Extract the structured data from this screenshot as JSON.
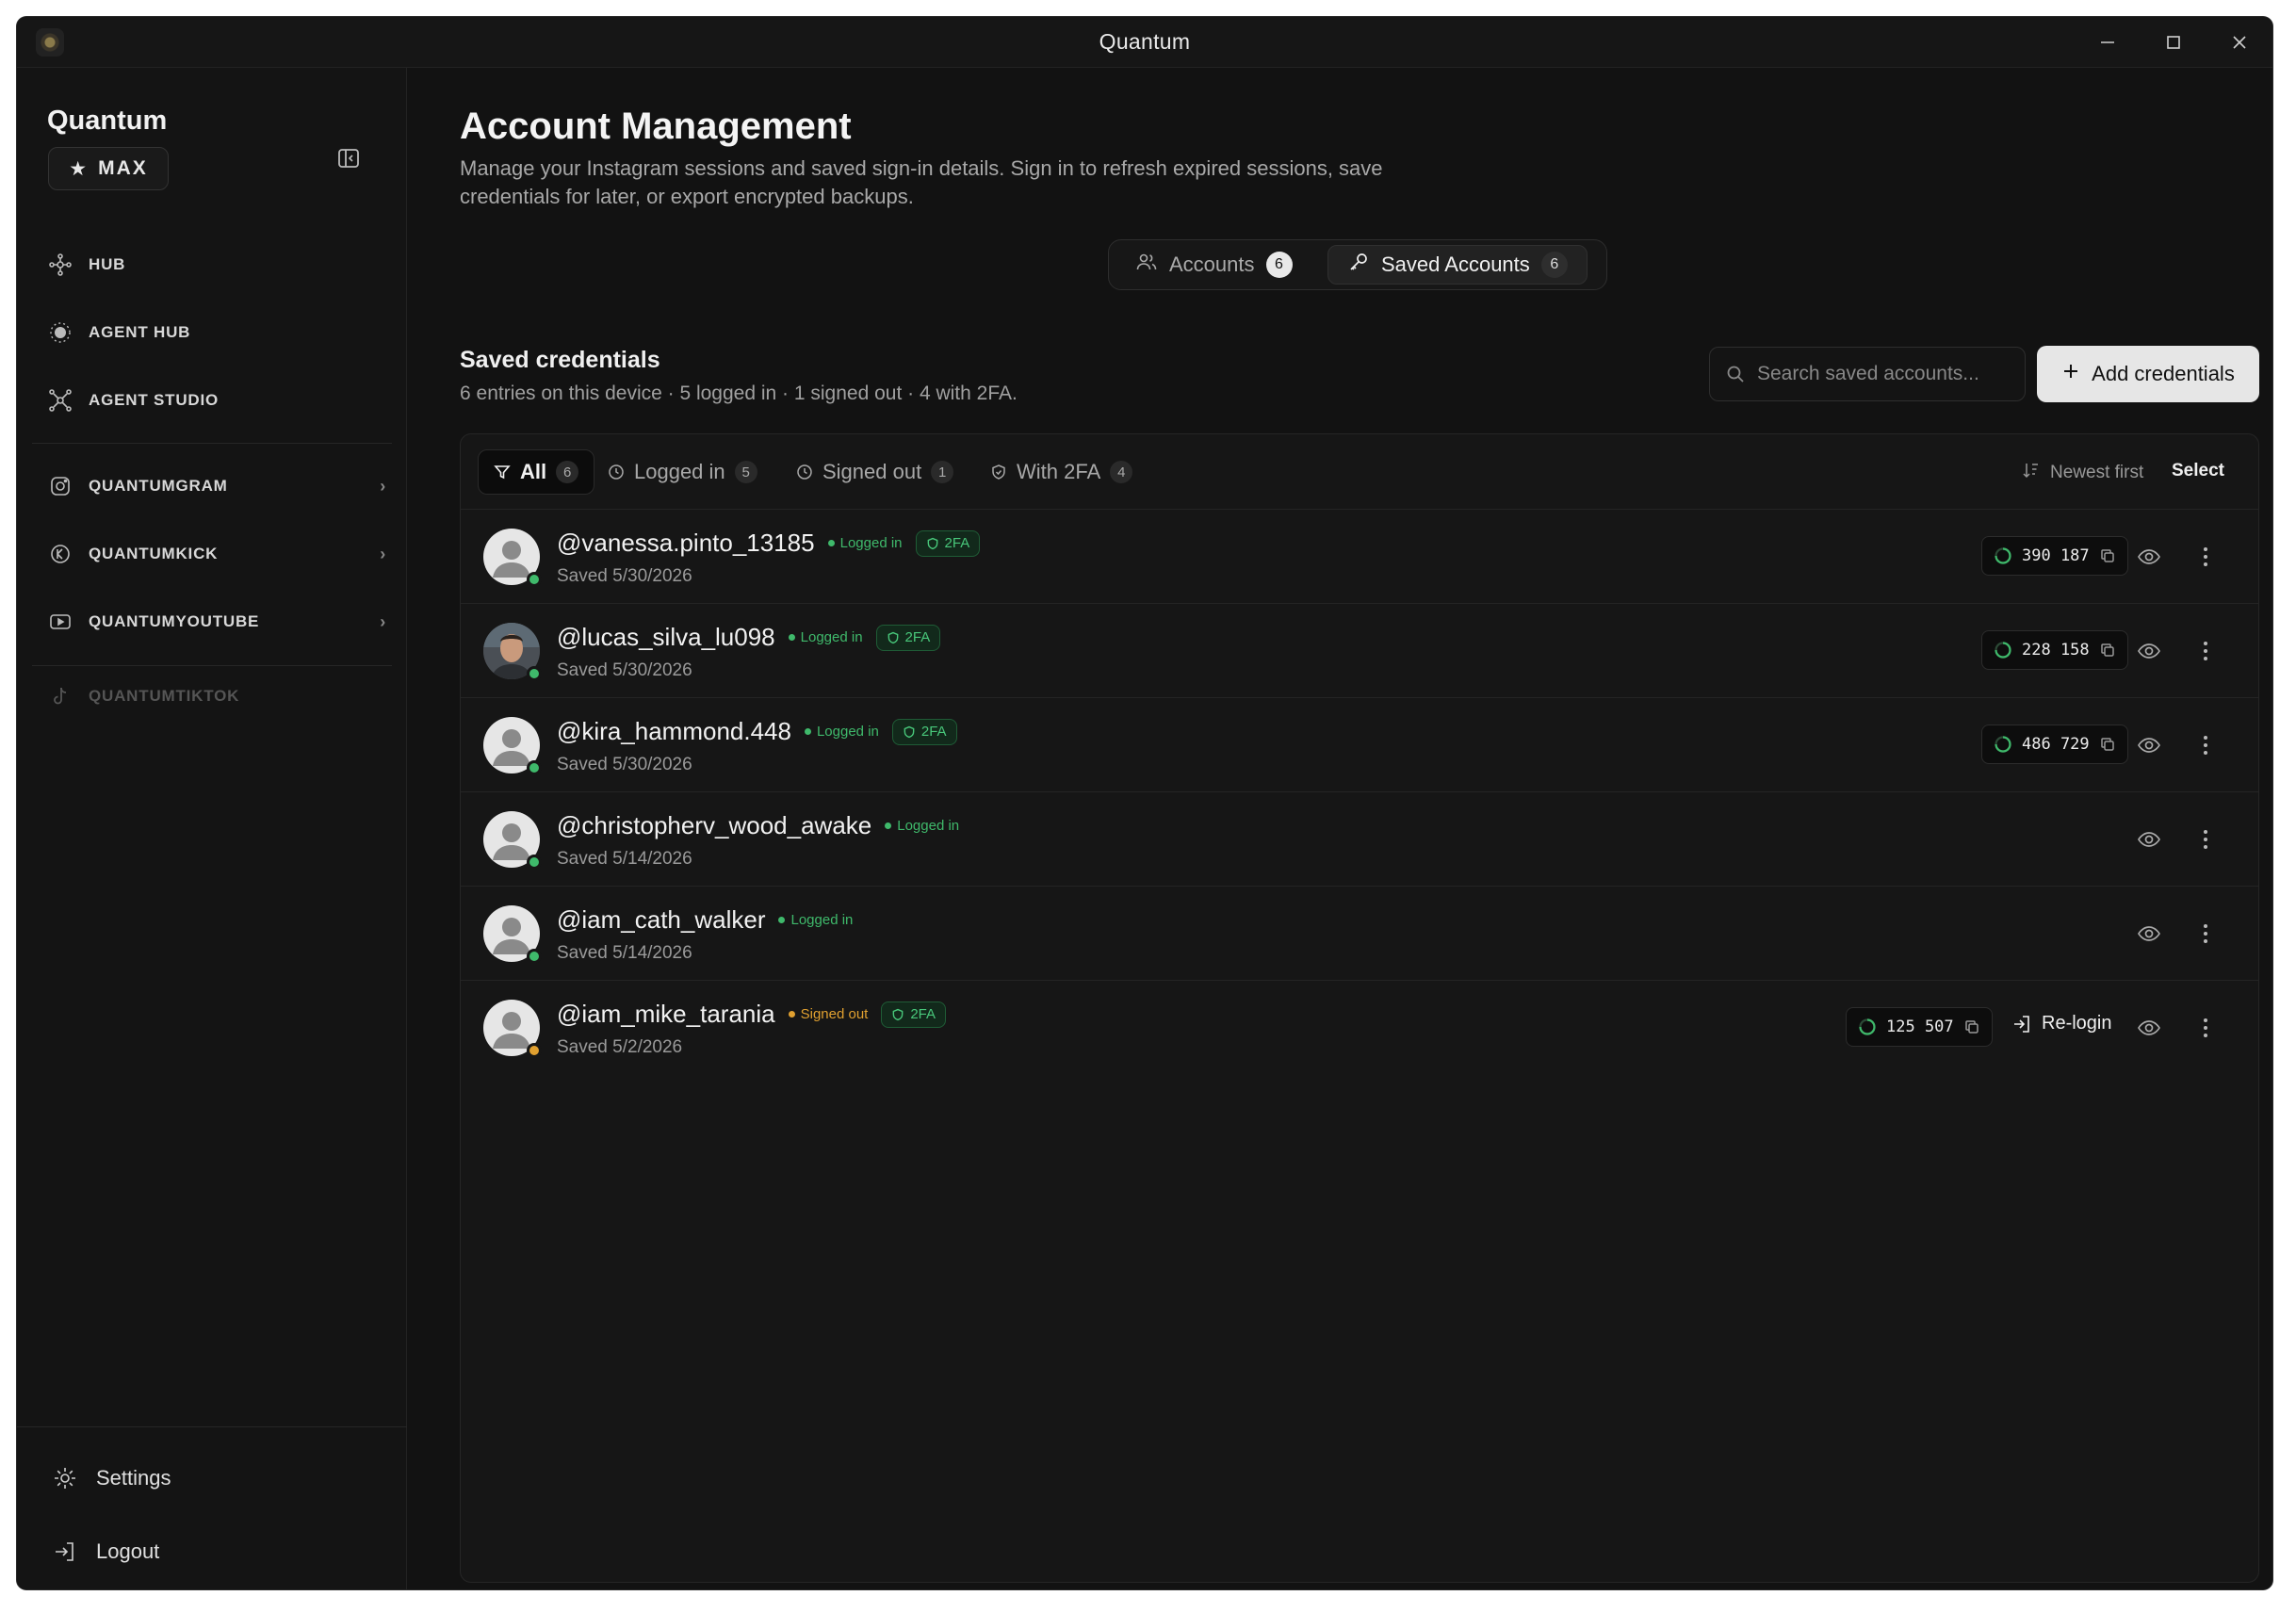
{
  "window": {
    "title": "Quantum"
  },
  "sidebar": {
    "brand": "Quantum",
    "plan_badge": "MAX",
    "items": [
      {
        "label": "HUB",
        "icon": "hub-icon"
      },
      {
        "label": "AGENT HUB",
        "icon": "agent-hub-icon"
      },
      {
        "label": "AGENT STUDIO",
        "icon": "agent-studio-icon"
      },
      {
        "label": "QUANTUMGRAM",
        "icon": "instagram-icon"
      },
      {
        "label": "QUANTUMKICK",
        "icon": "kick-icon"
      },
      {
        "label": "QUANTUMYOUTUBE",
        "icon": "youtube-icon"
      },
      {
        "label": "QUANTUMTIKTOK",
        "icon": "tiktok-icon"
      }
    ],
    "settings_label": "Settings",
    "logout_label": "Logout"
  },
  "header": {
    "title": "Account Management",
    "description": "Manage your Instagram sessions and saved sign-in details. Sign in to refresh expired sessions, save credentials for later, or export encrypted backups."
  },
  "tabs": [
    {
      "label": "Accounts",
      "count": "6"
    },
    {
      "label": "Saved Accounts",
      "count": "6"
    }
  ],
  "section": {
    "title": "Saved credentials",
    "subtitle": "6 entries on this device · 5 logged in · 1 signed out · 4 with 2FA.",
    "search_placeholder": "Search saved accounts...",
    "add_label": "Add credentials"
  },
  "filters": [
    {
      "label": "All",
      "count": "6"
    },
    {
      "label": "Logged in",
      "count": "5"
    },
    {
      "label": "Signed out",
      "count": "1"
    },
    {
      "label": "With 2FA",
      "count": "4"
    }
  ],
  "sort_label": "Newest first",
  "select_label": "Select",
  "accounts": [
    {
      "handle": "@vanessa.pinto_13185",
      "status": "Logged in",
      "tfa": "2FA",
      "saved": "Saved 5/30/2026",
      "code": "390 187"
    },
    {
      "handle": "@lucas_silva_lu098",
      "status": "Logged in",
      "tfa": "2FA",
      "saved": "Saved 5/30/2026",
      "code": "228 158"
    },
    {
      "handle": "@kira_hammond.448",
      "status": "Logged in",
      "tfa": "2FA",
      "saved": "Saved 5/30/2026",
      "code": "486 729"
    },
    {
      "handle": "@christopherv_wood_awake",
      "status": "Logged in",
      "saved": "Saved 5/14/2026"
    },
    {
      "handle": "@iam_cath_walker",
      "status": "Logged in",
      "saved": "Saved 5/14/2026"
    },
    {
      "handle": "@iam_mike_tarania",
      "status": "Signed out",
      "tfa": "2FA",
      "saved": "Saved 5/2/2026",
      "code": "125 507",
      "relogin": "Re-login"
    }
  ],
  "colors": {
    "logged_in": "#3fb96b",
    "signed_out": "#e0a030",
    "background": "#121212"
  }
}
